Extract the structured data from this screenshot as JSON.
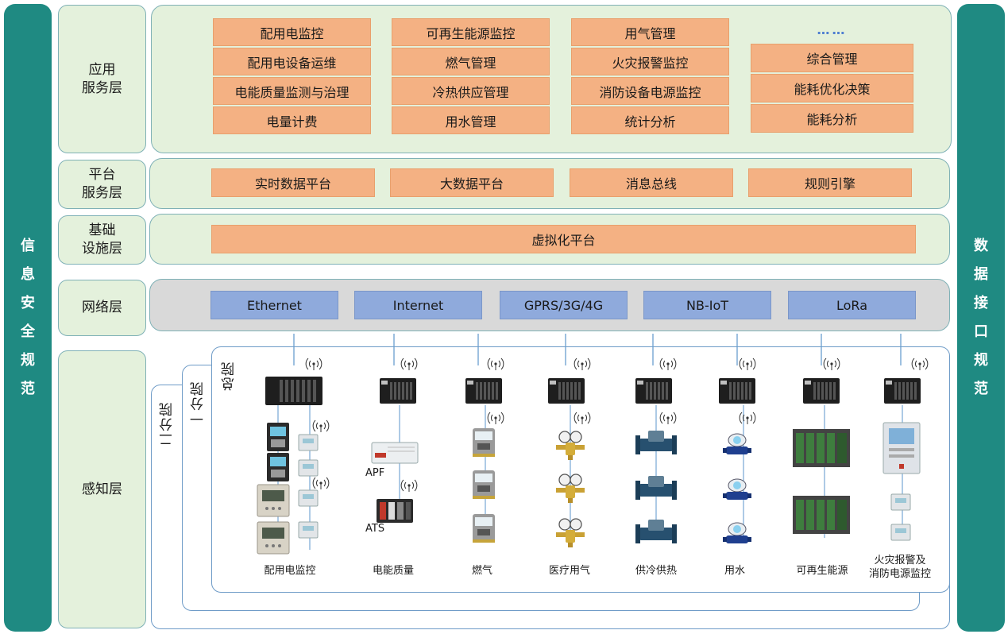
{
  "left_bar": {
    "chars": [
      "信",
      "息",
      "安",
      "全",
      "规",
      "范"
    ]
  },
  "right_bar": {
    "chars": [
      "数",
      "据",
      "接",
      "口",
      "规",
      "范"
    ]
  },
  "layers": {
    "application": "应用\n服务层",
    "platform": "平台\n服务层",
    "infrastructure": "基础\n设施层",
    "network": "网络层",
    "perception": "感知层"
  },
  "application_columns": [
    [
      "配用电监控",
      "配用电设备运维",
      "电能质量监测与治理",
      "电量计费"
    ],
    [
      "可再生能源监控",
      "燃气管理",
      "冷热供应管理",
      "用水管理"
    ],
    [
      "用气管理",
      "火灾报警监控",
      "消防设备电源监控",
      "统计分析"
    ],
    [
      "综合管理",
      "能耗优化决策",
      "能耗分析"
    ]
  ],
  "ellipsis": "……",
  "platform_items": [
    "实时数据平台",
    "大数据平台",
    "消息总线",
    "规则引擎"
  ],
  "infrastructure_item": "虚拟化平台",
  "network_items": [
    "Ethernet",
    "Internet",
    "GPRS/3G/4G",
    "NB-IoT",
    "LoRa"
  ],
  "hospitals": {
    "second": "二分院",
    "first": "一分院",
    "main": "总院"
  },
  "device_labels": {
    "apf": "APF",
    "ats": "ATS"
  },
  "device_groups": [
    "配用电监控",
    "电能质量",
    "燃气",
    "医疗用气",
    "供冷供热",
    "用水",
    "可再生能源",
    "火灾报警及\n消防电源监控"
  ],
  "colors": {
    "teal": "#1f8a82",
    "green": "#e4f1dc",
    "orange": "#f4b183",
    "blue": "#8faadc",
    "gray": "#d9d9d9"
  }
}
